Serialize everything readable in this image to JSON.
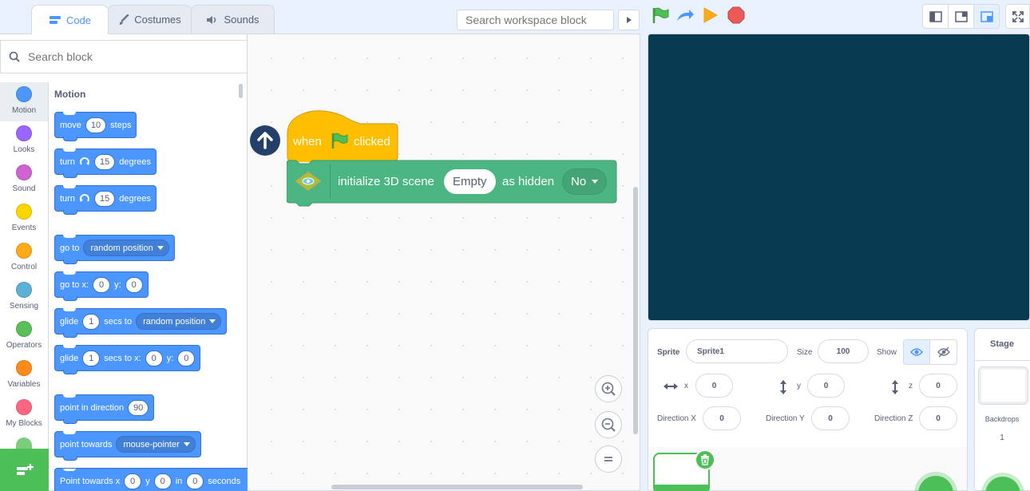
{
  "tabs": {
    "code": "Code",
    "costumes": "Costumes",
    "sounds": "Sounds"
  },
  "workspace_search": {
    "placeholder": "Search workspace block"
  },
  "block_search": {
    "placeholder": "Search block"
  },
  "categories": [
    {
      "label": "Motion",
      "color": "#4c97ff"
    },
    {
      "label": "Looks",
      "color": "#9966ff"
    },
    {
      "label": "Sound",
      "color": "#cf63cf"
    },
    {
      "label": "Events",
      "color": "#ffd500"
    },
    {
      "label": "Control",
      "color": "#ffab19"
    },
    {
      "label": "Sensing",
      "color": "#5cb1d6"
    },
    {
      "label": "Operators",
      "color": "#59c059"
    },
    {
      "label": "Variables",
      "color": "#ff8c1a"
    },
    {
      "label": "My Blocks",
      "color": "#ff6680"
    }
  ],
  "palette": {
    "heading": "Motion",
    "move": {
      "pre": "move",
      "value": "10",
      "post": "steps"
    },
    "turn_right": {
      "pre": "turn",
      "value": "15",
      "post": "degrees"
    },
    "turn_left": {
      "pre": "turn",
      "value": "15",
      "post": "degrees"
    },
    "goto": {
      "pre": "go to",
      "option": "random position"
    },
    "goto_xy": {
      "pre": "go to x:",
      "x": "0",
      "ylabel": "y:",
      "y": "0"
    },
    "glide": {
      "pre": "glide",
      "value": "1",
      "mid": "secs to",
      "option": "random position"
    },
    "glide_xy": {
      "pre": "glide",
      "value": "1",
      "mid": "secs to x:",
      "x": "0",
      "ylabel": "y:",
      "y": "0"
    },
    "point_direction": {
      "pre": "point in direction",
      "value": "90"
    },
    "point_towards": {
      "pre": "point towards",
      "option": "mouse-pointer"
    },
    "point_towards_xy": {
      "pre": "Point towards x",
      "x": "0",
      "ylabel": "y",
      "y": "0",
      "inlabel": "in",
      "in": "0",
      "post": "seconds"
    }
  },
  "script": {
    "hat": {
      "pre": "when",
      "post": "clicked"
    },
    "init": {
      "label": "initialize 3D scene",
      "scene": "Empty",
      "hidden_label": "as hidden",
      "hidden": "No"
    }
  },
  "sprite_info": {
    "sprite_label": "Sprite",
    "sprite_name": "Sprite1",
    "size_label": "Size",
    "size": "100",
    "show_label": "Show",
    "x_label": "x",
    "x": "0",
    "y_label": "y",
    "y": "0",
    "z_label": "z",
    "z": "0",
    "dirx_label": "Direction X",
    "dirx": "0",
    "diry_label": "Direction Y",
    "diry": "0",
    "dirz_label": "Direction Z",
    "dirz": "0"
  },
  "stage_panel": {
    "title": "Stage",
    "backdrops_label": "Backdrops",
    "backdrops_count": "1"
  },
  "colors": {
    "stage": "#063b51",
    "motion": "#4c97ff",
    "events": "#ffbf00",
    "extension": "#4cb683",
    "green": "#4cbf56"
  }
}
